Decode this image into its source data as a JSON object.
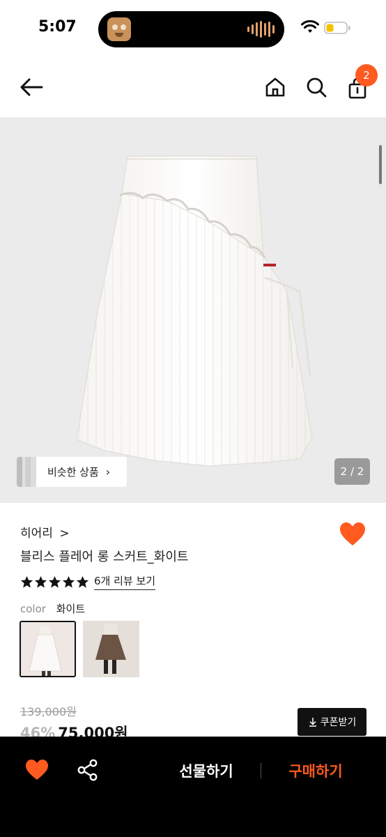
{
  "status": {
    "time": "5:07"
  },
  "nav": {
    "cart_count": "2"
  },
  "gallery": {
    "similar_label": "비슷한 상품",
    "page_indicator": "2 / 2"
  },
  "product": {
    "brand": "히어리",
    "brand_chevron": ">",
    "title": "블리스 플레어 롱 스커트_화이트",
    "rating_stars": 5,
    "review_link": "6개 리뷰 보기",
    "color_label": "color",
    "color_value": "화이트",
    "original_price": "139,000원",
    "discount": "46%",
    "sale_price": "75,000원",
    "coupon_label": "쿠폰받기"
  },
  "bottom_bar": {
    "gift_label": "선물하기",
    "buy_label": "구매하기"
  },
  "colors": {
    "accent": "#ff5a1f",
    "dark": "#000000"
  },
  "icons": [
    "back-arrow-icon",
    "home-icon",
    "search-icon",
    "cart-icon",
    "heart-icon",
    "share-icon",
    "star-icon",
    "download-icon",
    "wifi-icon",
    "battery-icon"
  ]
}
